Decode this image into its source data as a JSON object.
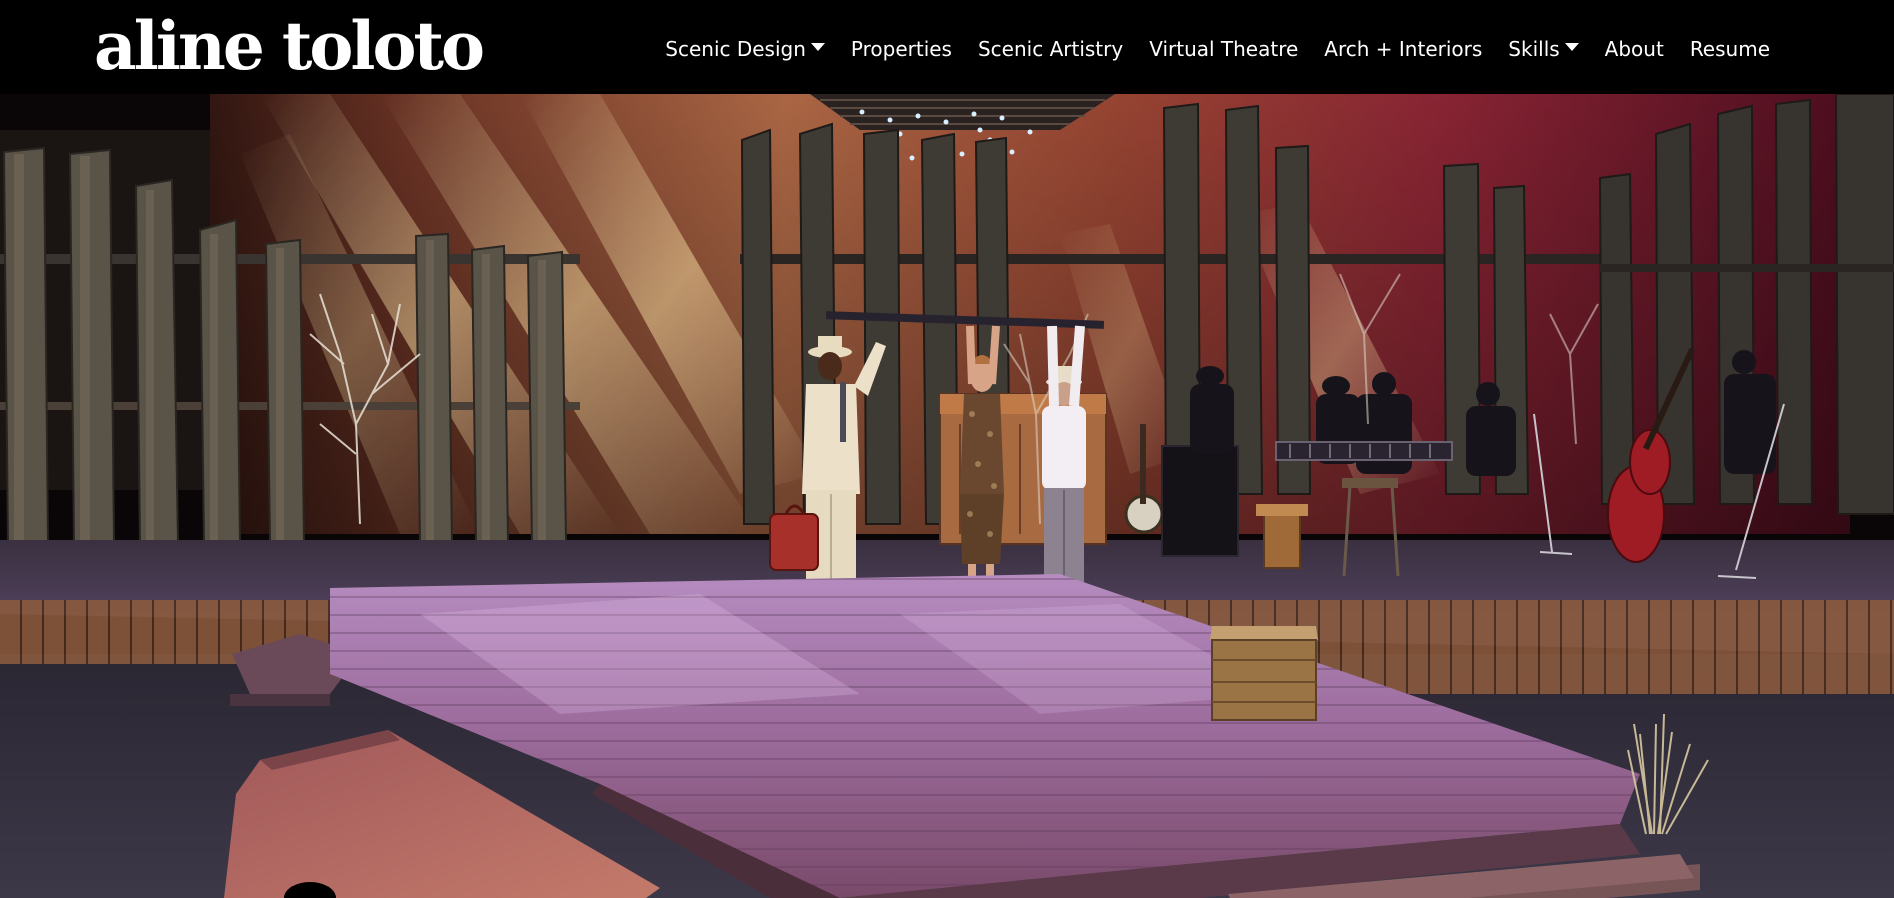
{
  "brand": {
    "name": "aline toloto"
  },
  "nav": {
    "items": [
      {
        "label": "Scenic Design",
        "has_dropdown": true
      },
      {
        "label": "Properties",
        "has_dropdown": false
      },
      {
        "label": "Scenic Artistry",
        "has_dropdown": false
      },
      {
        "label": "Virtual Theatre",
        "has_dropdown": false
      },
      {
        "label": "Arch + Interiors",
        "has_dropdown": false
      },
      {
        "label": "Skills",
        "has_dropdown": true
      },
      {
        "label": "About",
        "has_dropdown": false
      },
      {
        "label": "Resume",
        "has_dropdown": false
      }
    ]
  },
  "colors": {
    "navbar_bg": "#000000",
    "nav_text": "#ffffff",
    "backdrop_warm": "#e8a060",
    "backdrop_magenta": "#a0203c",
    "deck_purple": "#8a5a8c"
  },
  "hero": {
    "icon": "stage-photo-image"
  }
}
